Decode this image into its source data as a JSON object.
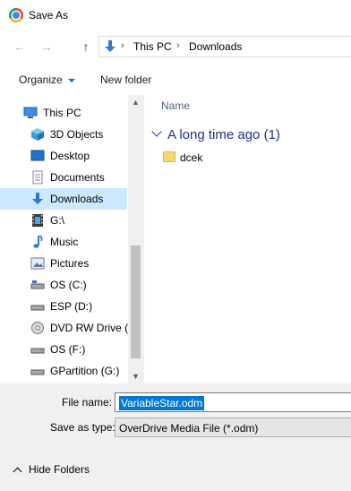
{
  "window": {
    "title": "Save As",
    "app_icon": "chrome-icon"
  },
  "nav": {
    "back_icon": "back-arrow-icon",
    "forward_icon": "forward-arrow-icon",
    "up_icon": "up-arrow-icon",
    "breadcrumb": [
      "This PC",
      "Downloads"
    ],
    "location_icon": "downloads-icon"
  },
  "toolbar": {
    "organize_label": "Organize",
    "new_folder_label": "New folder"
  },
  "sidebar": {
    "root": {
      "label": "This PC",
      "icon": "computer-icon"
    },
    "items": [
      {
        "label": "3D Objects",
        "icon": "3d-objects-icon"
      },
      {
        "label": "Desktop",
        "icon": "desktop-icon"
      },
      {
        "label": "Documents",
        "icon": "documents-icon"
      },
      {
        "label": "Downloads",
        "icon": "downloads-icon",
        "selected": true
      },
      {
        "label": "G:\\",
        "icon": "film-icon"
      },
      {
        "label": "Music",
        "icon": "music-icon"
      },
      {
        "label": "Pictures",
        "icon": "pictures-icon"
      },
      {
        "label": "OS (C:)",
        "icon": "drive-icon"
      },
      {
        "label": "ESP (D:)",
        "icon": "drive-icon"
      },
      {
        "label": "DVD RW Drive (E",
        "icon": "dvd-drive-icon"
      },
      {
        "label": "OS (F:)",
        "icon": "drive-icon"
      },
      {
        "label": "GPartition (G:)",
        "icon": "drive-icon"
      }
    ]
  },
  "content": {
    "column_header": "Name",
    "group_label": "A long time ago (1)",
    "files": [
      {
        "name": "dcek",
        "icon": "folder-icon"
      }
    ]
  },
  "form": {
    "filename_label": "File name:",
    "filename_value": "VariableStar.odm",
    "savetype_label": "Save as type:",
    "savetype_value": "OverDrive Media File (*.odm)"
  },
  "footer": {
    "hide_folders_label": "Hide Folders"
  },
  "colors": {
    "selection": "#cce8ff",
    "accent": "#0078d7",
    "group_header": "#1e3287"
  }
}
